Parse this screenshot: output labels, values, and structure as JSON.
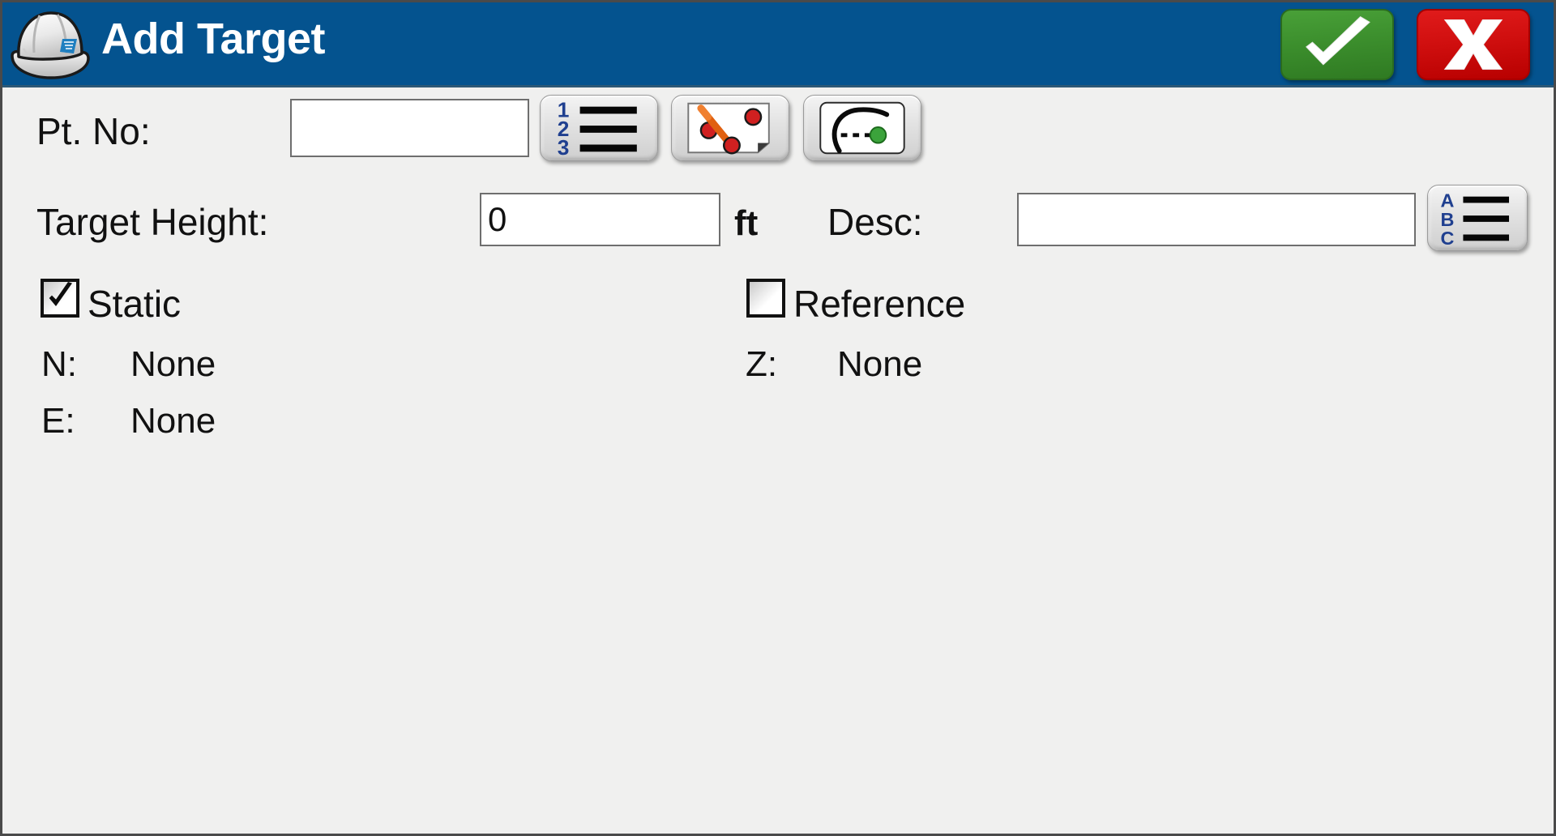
{
  "window": {
    "title": "Add Target",
    "app_icon": "hardhat-icon",
    "titlebar_color": "#04538f",
    "body_color": "#f0f0ef"
  },
  "titlebar": {
    "accept": {
      "label": "",
      "icon": "checkmark-icon",
      "color": "#3c8f2d"
    },
    "cancel": {
      "label": "X",
      "icon": "x-icon",
      "color": "#d00f0f"
    }
  },
  "form": {
    "pt_no": {
      "label": "Pt. No:",
      "value": "",
      "placeholder": ""
    },
    "pt_no_buttons": [
      {
        "name": "point-list-button",
        "icon": "numbered-list-icon",
        "digits": [
          "1",
          "2",
          "3"
        ]
      },
      {
        "name": "pick-from-map-button",
        "icon": "map-pick-point-icon"
      },
      {
        "name": "radius-point-button",
        "icon": "arc-radius-icon"
      }
    ],
    "target_height": {
      "label": "Target Height:",
      "value": "0",
      "units": "ft"
    },
    "desc": {
      "label": "Desc:",
      "value": "",
      "placeholder": "",
      "button": {
        "name": "description-list-button",
        "icon": "abc-list-icon",
        "letters": [
          "A",
          "B",
          "C"
        ]
      }
    },
    "checkboxes": [
      {
        "name": "static-checkbox",
        "label": "Static",
        "checked": true
      },
      {
        "name": "reference-checkbox",
        "label": "Reference",
        "checked": false
      }
    ],
    "coordinates": [
      {
        "name": "northing",
        "label": "N:",
        "value": "None"
      },
      {
        "name": "easting",
        "label": "E:",
        "value": "None"
      },
      {
        "name": "elevation",
        "label": "Z:",
        "value": "None"
      }
    ]
  }
}
